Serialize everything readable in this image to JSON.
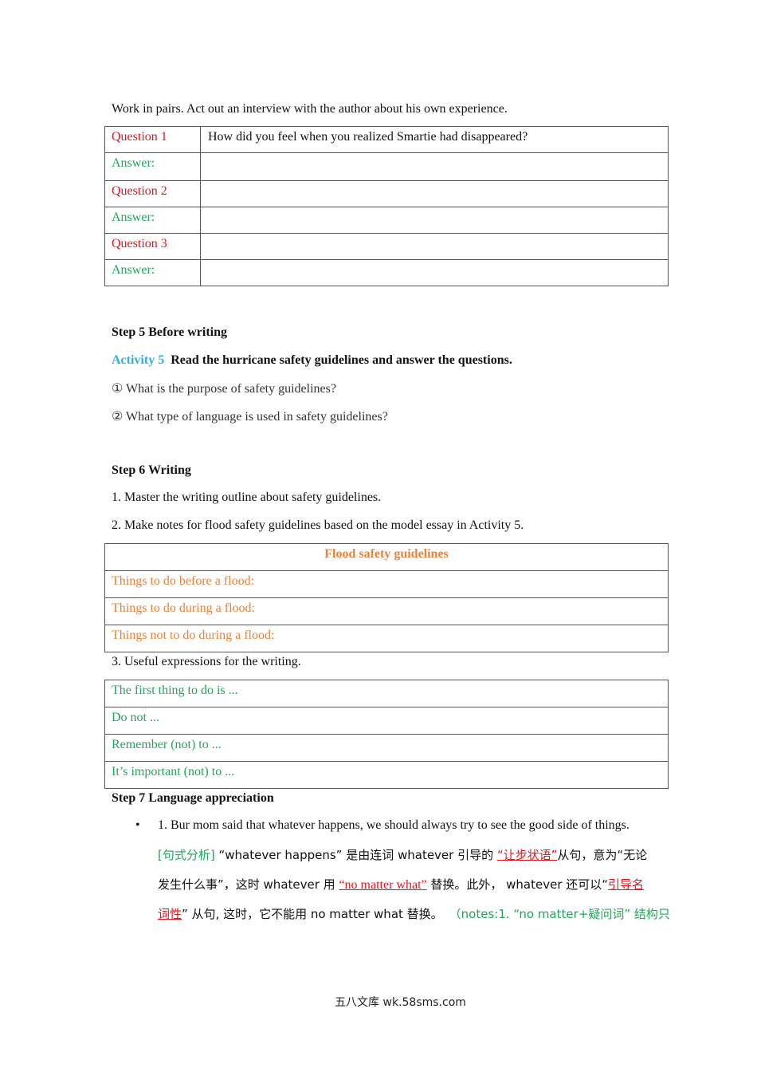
{
  "intro": "Work in pairs. Act out an interview with the author about his own experience.",
  "interview_table": {
    "rows": [
      {
        "label": "Question 1",
        "content": "How did you feel when you realized Smartie had disappeared?",
        "type": "question"
      },
      {
        "label": "Answer:",
        "content": "",
        "type": "answer"
      },
      {
        "label": "Question 2",
        "content": "",
        "type": "question"
      },
      {
        "label": "Answer:",
        "content": "",
        "type": "answer"
      },
      {
        "label": "Question 3",
        "content": "",
        "type": "question"
      },
      {
        "label": "Answer:",
        "content": "",
        "type": "answer"
      }
    ]
  },
  "step5": {
    "title": "Step 5  Before writing",
    "activity_label": "Activity 5",
    "activity_text": "Read the hurricane safety guidelines and answer the questions.",
    "questions": [
      "① What is the purpose of safety guidelines?",
      "② What type of language is used in safety guidelines?"
    ]
  },
  "step6": {
    "title": "Step 6  Writing",
    "item1": "1. Master the writing outline  about safety guidelines.",
    "item2": "2. Make notes for flood safety guidelines based on the model essay in Activity 5.",
    "flood_table": {
      "header": "Flood safety guidelines",
      "rows": [
        "Things to do before a flood:",
        "Things to do during a flood:",
        "Things not to do during a flood:"
      ]
    },
    "item3": "3. Useful expressions for the writing.",
    "expressions": [
      "The first thing to do is ...",
      "Do not ...",
      "Remember (not) to ...",
      "It’s important (not) to ..."
    ]
  },
  "step7": {
    "title": "Step 7   Language appreciation",
    "bullet": "•",
    "sentence": "1. Bur mom said that whatever happens, we should always try to see the good side of things.",
    "analysis": {
      "tag": "[句式分析]",
      "p1": " “whatever happens” 是由连词 whatever 引导的 ",
      "hl1": "“让步状语”",
      "p2": "从句，意为“无论",
      "p3": "发生什么事”，这时 whatever 用 ",
      "hl2": "“no matter what”",
      "p4": " 替换。此外，  whatever 还可以“",
      "hl3a": "引导名",
      "hl3b": "词性",
      "p5": "” 从句, 这时，它不能用  no matter what 替换。",
      "note": "（notes:1. “no matter+疑问词” 结构只"
    }
  },
  "footer": "五八文库 wk.58sms.com",
  "colors": {
    "question": "#e8141d",
    "answer": "#22a65a",
    "activity": "#2cb0e0",
    "flood": "#e6833c"
  }
}
